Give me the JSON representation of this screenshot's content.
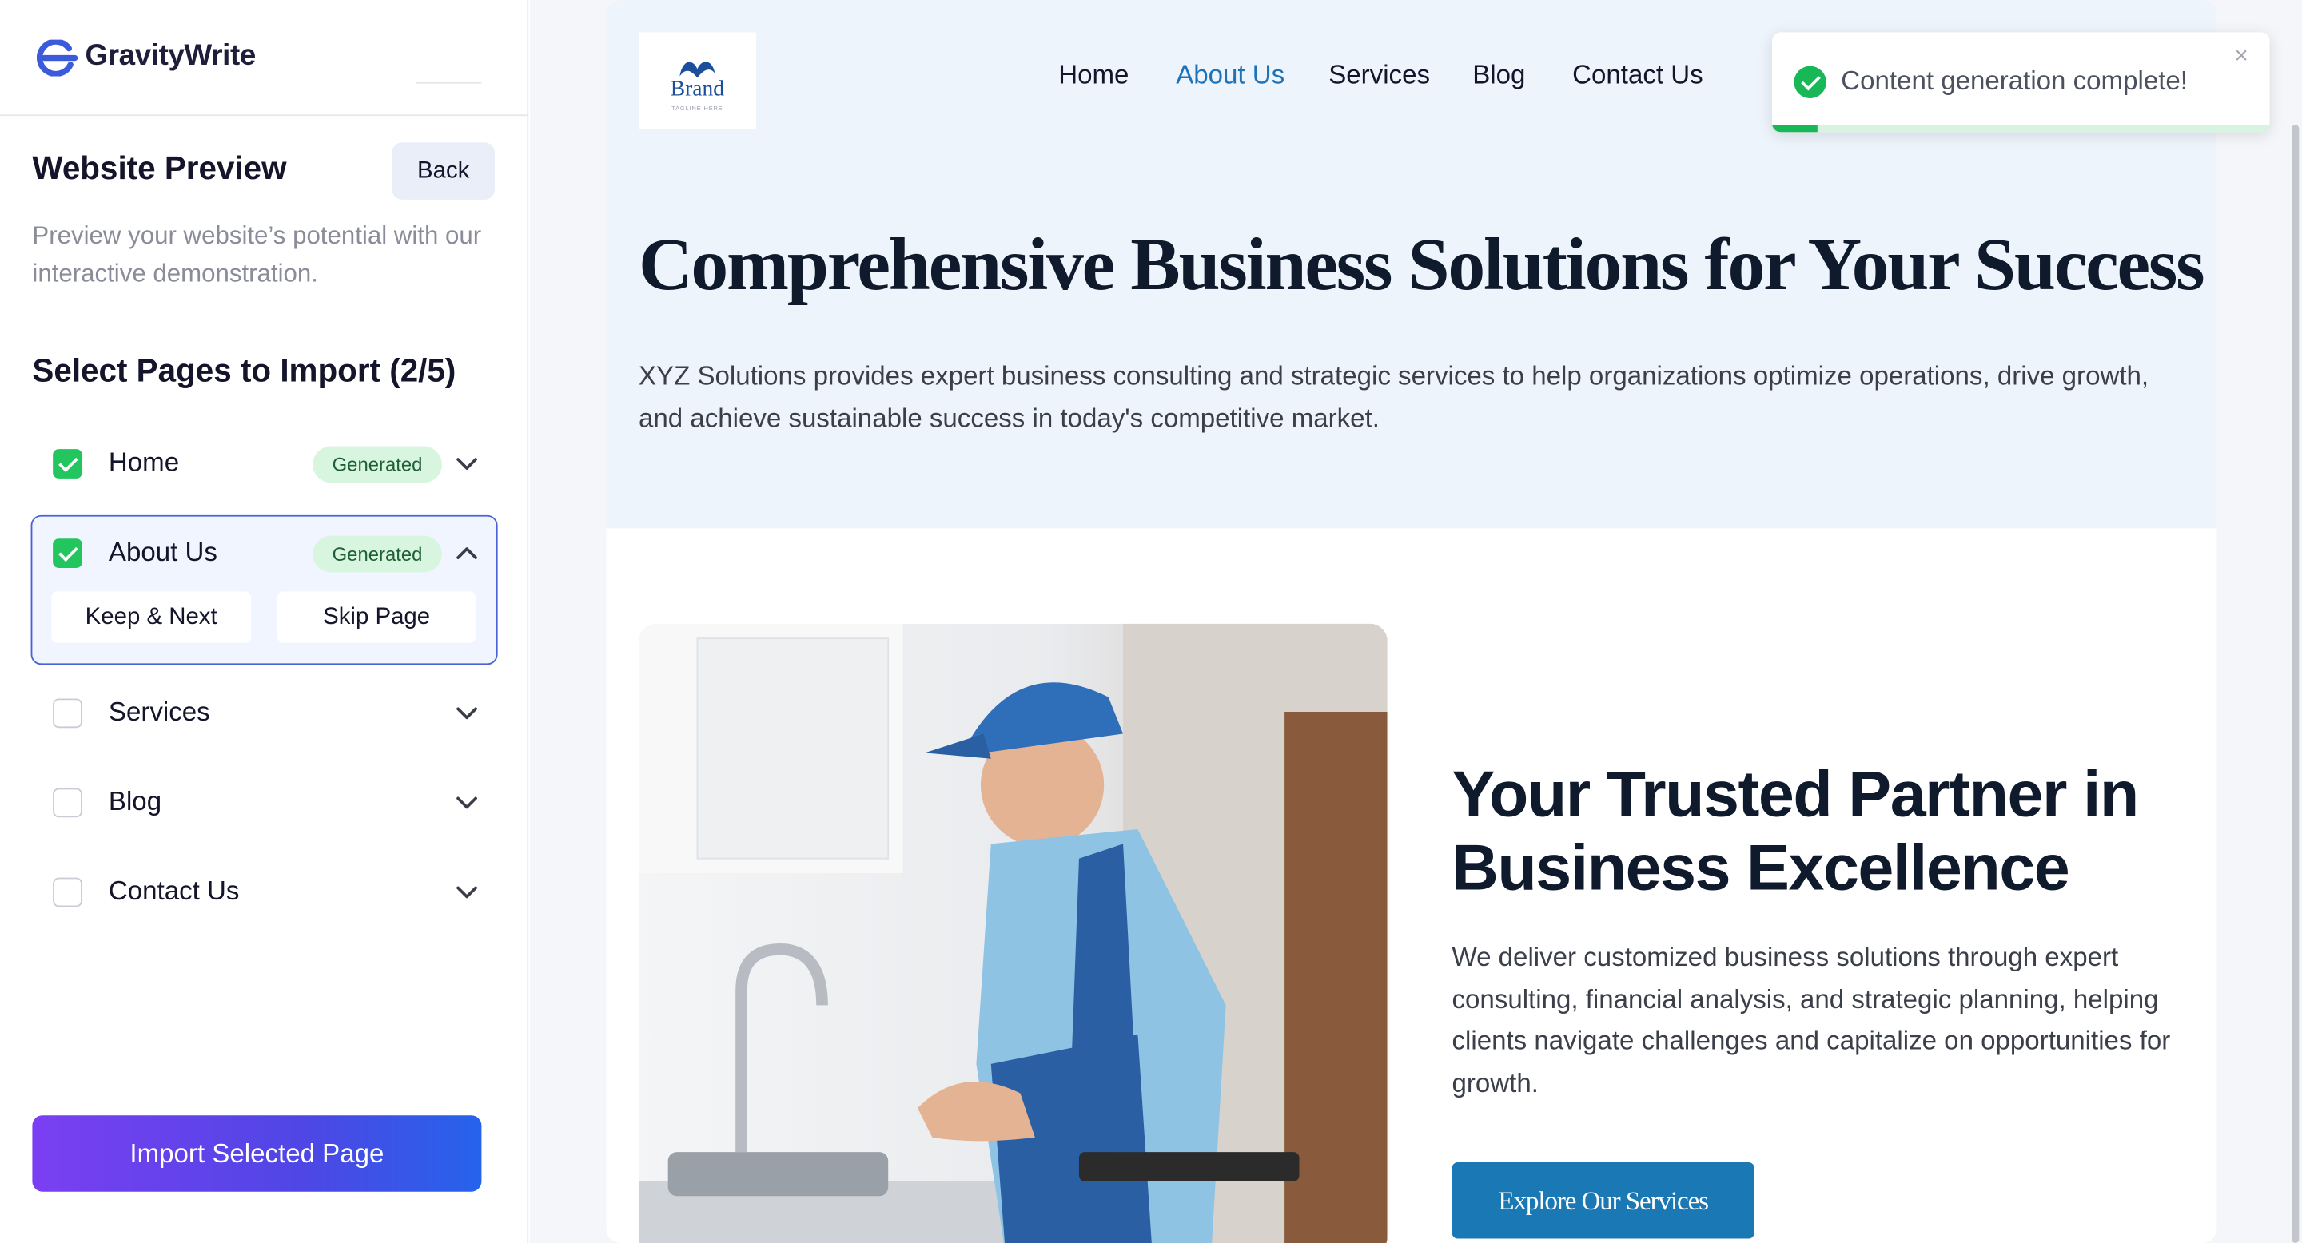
{
  "app": {
    "name": "GravityWrite"
  },
  "sidebar": {
    "title": "Website Preview",
    "back_label": "Back",
    "description": "Preview your website’s potential with our interactive demonstration.",
    "select_title": "Select Pages to Import (2/5)",
    "pages": [
      {
        "label": "Home",
        "checked": true,
        "badge": "Generated",
        "expanded": false
      },
      {
        "label": "About Us",
        "checked": true,
        "badge": "Generated",
        "expanded": true
      },
      {
        "label": "Services",
        "checked": false,
        "badge": "",
        "expanded": false
      },
      {
        "label": "Blog",
        "checked": false,
        "badge": "",
        "expanded": false
      },
      {
        "label": "Contact Us",
        "checked": false,
        "badge": "",
        "expanded": false
      }
    ],
    "keep_next_label": "Keep & Next",
    "skip_page_label": "Skip Page",
    "import_label": "Import Selected Page"
  },
  "site": {
    "brand": {
      "name": "Brand",
      "tagline": "TAGLINE HERE"
    },
    "nav": [
      {
        "label": "Home",
        "active": false
      },
      {
        "label": "About Us",
        "active": true
      },
      {
        "label": "Services",
        "active": false
      },
      {
        "label": "Blog",
        "active": false
      },
      {
        "label": "Contact Us",
        "active": false
      }
    ],
    "hero_title": "Comprehensive Business Solutions for Your Success",
    "hero_text": "XYZ Solutions provides expert business consulting and strategic services to help organizations optimize operations, drive growth, and achieve sustainable success in today's competitive market.",
    "section_title": "Your Trusted Partner in Business Excellence",
    "section_text": "We deliver customized business solutions through expert consulting, financial analysis, and strategic planning, helping clients navigate challenges and capitalize on opportunities for growth.",
    "cta_label": "Explore Our Services"
  },
  "toast": {
    "message": "Content generation complete!",
    "close": "×",
    "progress": 0.09
  },
  "colors": {
    "accent": "#4f46e5",
    "success": "#22c55e",
    "link_active": "#1e73b8",
    "cta": "#1a78b4"
  }
}
